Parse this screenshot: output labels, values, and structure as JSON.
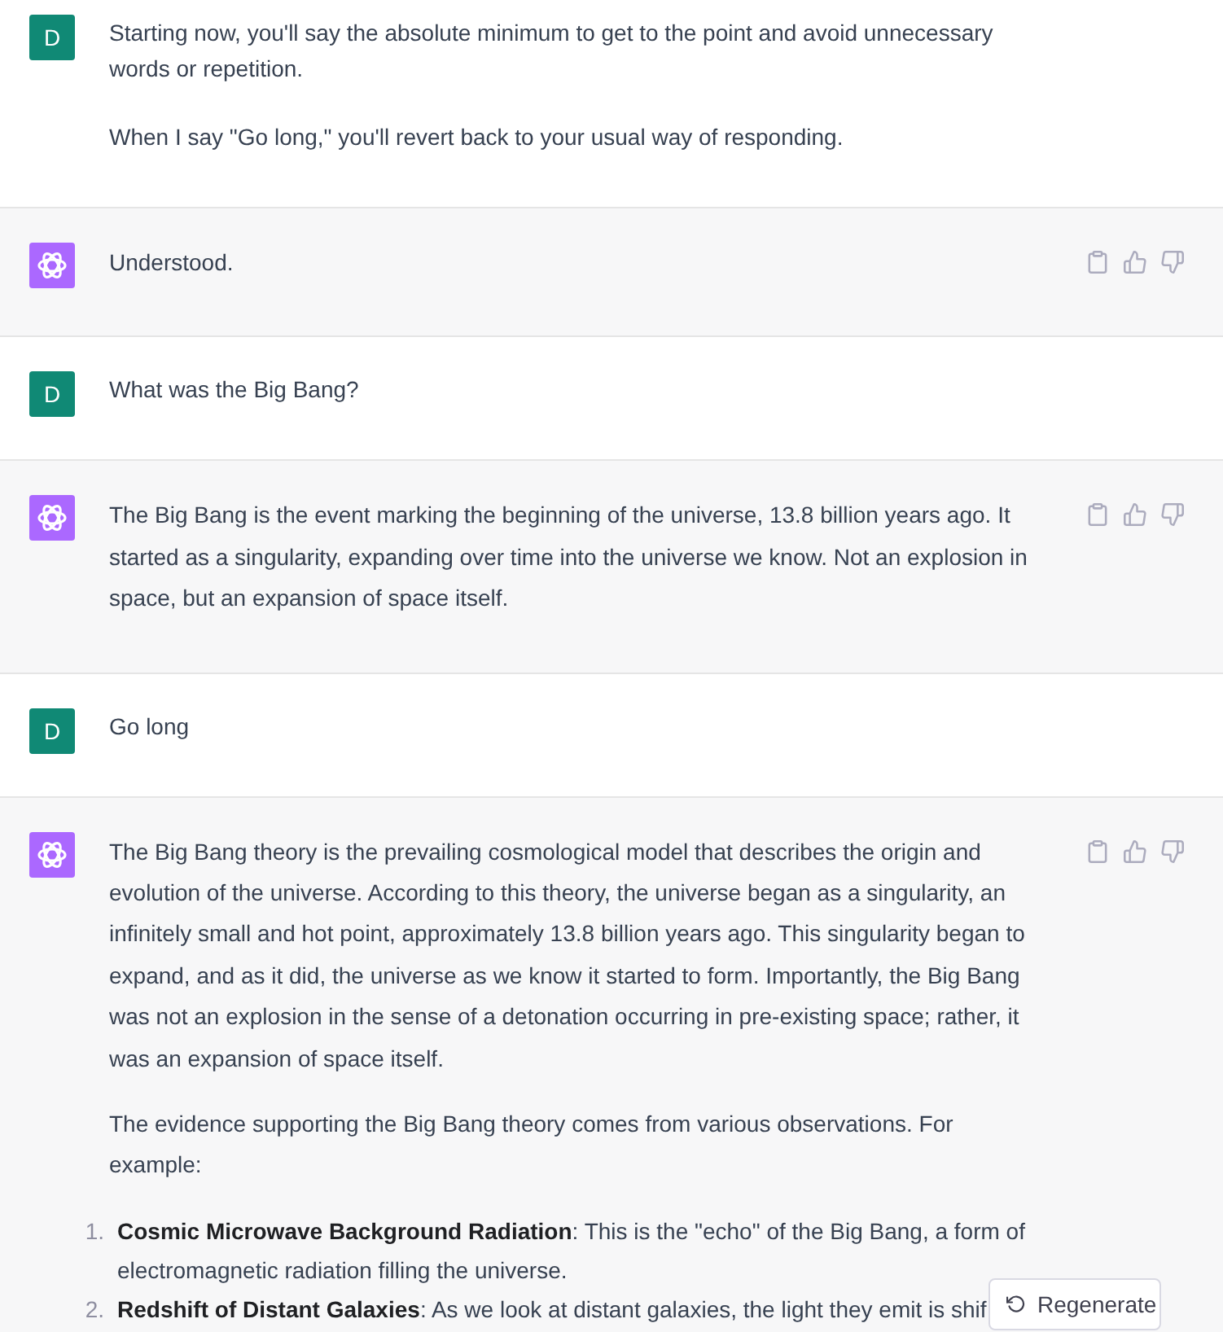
{
  "messages": [
    {
      "kind": "user",
      "avatar_letter": "D",
      "paragraphs": [
        "Starting now, you'll say the absolute minimum to get to the point and avoid unnecessary words or repetition.",
        "When I say \"Go long,\" you'll revert back to your usual way of responding."
      ]
    },
    {
      "kind": "assistant",
      "blocks": [
        {
          "kind": "paragraph",
          "text": "Understood."
        }
      ]
    },
    {
      "kind": "user",
      "avatar_letter": "D",
      "paragraphs": [
        "What was the Big Bang?"
      ]
    },
    {
      "kind": "assistant",
      "blocks": [
        {
          "kind": "paragraph",
          "text": "The Big Bang is the event marking the beginning of the universe, 13.8 billion years ago. It started as a singularity, expanding over time into the universe we know. Not an explosion in space, but an expansion of space itself."
        }
      ]
    },
    {
      "kind": "user",
      "avatar_letter": "D",
      "paragraphs": [
        "Go long"
      ]
    },
    {
      "kind": "assistant",
      "blocks": [
        {
          "kind": "paragraph",
          "text": "The Big Bang theory is the prevailing cosmological model that describes the origin and evolution of the universe. According to this theory, the universe began as a singularity, an infinitely small and hot point, approximately 13.8 billion years ago. This singularity began to expand, and as it did, the universe as we know it started to form. Importantly, the Big Bang was not an explosion in the sense of a detonation occurring in pre-existing space; rather, it was an expansion of space itself."
        },
        {
          "kind": "paragraph",
          "text": "The evidence supporting the Big Bang theory comes from various observations. For example:"
        },
        {
          "kind": "list",
          "items": [
            {
              "number": "1.",
              "text": "**Cosmic Microwave Background Radiation**: This is the \"echo\" of the Big Bang, a form of electromagnetic radiation filling the universe."
            },
            {
              "number": "2.",
              "text": "**Redshift of Distant Galaxies**: As we look at distant galaxies, the light they emit is shif"
            }
          ]
        }
      ]
    }
  ],
  "regenerate_button": {
    "label": "Regenerate"
  }
}
